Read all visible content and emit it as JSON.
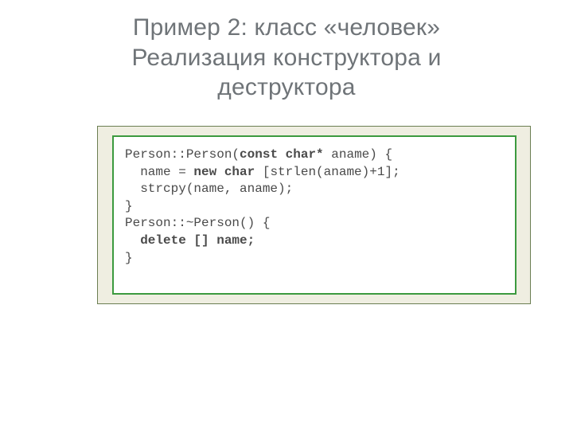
{
  "title_line1": "Пример 2: класс «человек»",
  "title_line2": "Реализация конструктора и",
  "title_line3": "деструктора",
  "code": {
    "l1a": "Person::Person(",
    "l1b": "const char*",
    "l1c": " aname) {",
    "l2a": "  name = ",
    "l2b": "new char",
    "l2c": " [strlen(aname)+1];",
    "l3": "  strcpy(name, aname);",
    "l4": "}",
    "l5": "Person::~Person() {",
    "l6a": "  ",
    "l6b": "delete [] name;",
    "l7": "}"
  }
}
